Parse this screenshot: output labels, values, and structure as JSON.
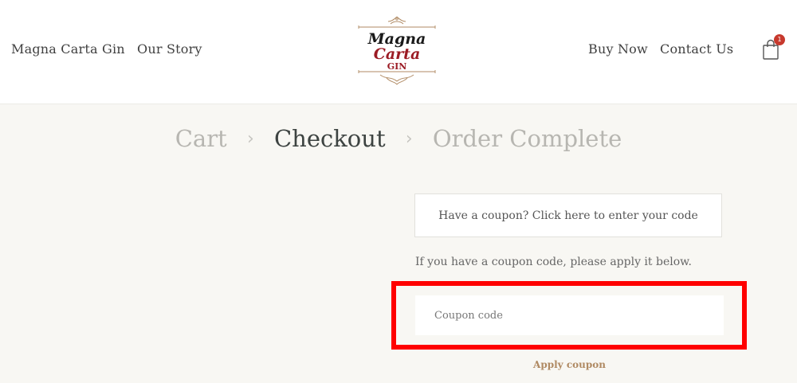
{
  "header": {
    "nav_left": [
      "Magna Carta Gin",
      "Our Story"
    ],
    "nav_right": [
      "Buy Now",
      "Contact Us"
    ],
    "logo": {
      "line1": "Magna",
      "line2": "Carta",
      "line3": "GIN"
    },
    "cart_count": "1",
    "colors": {
      "logo_black": "#1a1a1a",
      "logo_red": "#9b1b24",
      "logo_gold": "#b08a63",
      "badge": "#c7392d"
    }
  },
  "steps": {
    "items": [
      "Cart",
      "Checkout",
      "Order Complete"
    ],
    "active": "Checkout"
  },
  "coupon": {
    "toggle_text": "Have a coupon? Click here to enter your code",
    "info_text": "If you have a coupon code, please apply it below.",
    "input_placeholder": "Coupon code",
    "input_value": "",
    "apply_label": "Apply coupon"
  },
  "highlight_color": "#ff0000"
}
